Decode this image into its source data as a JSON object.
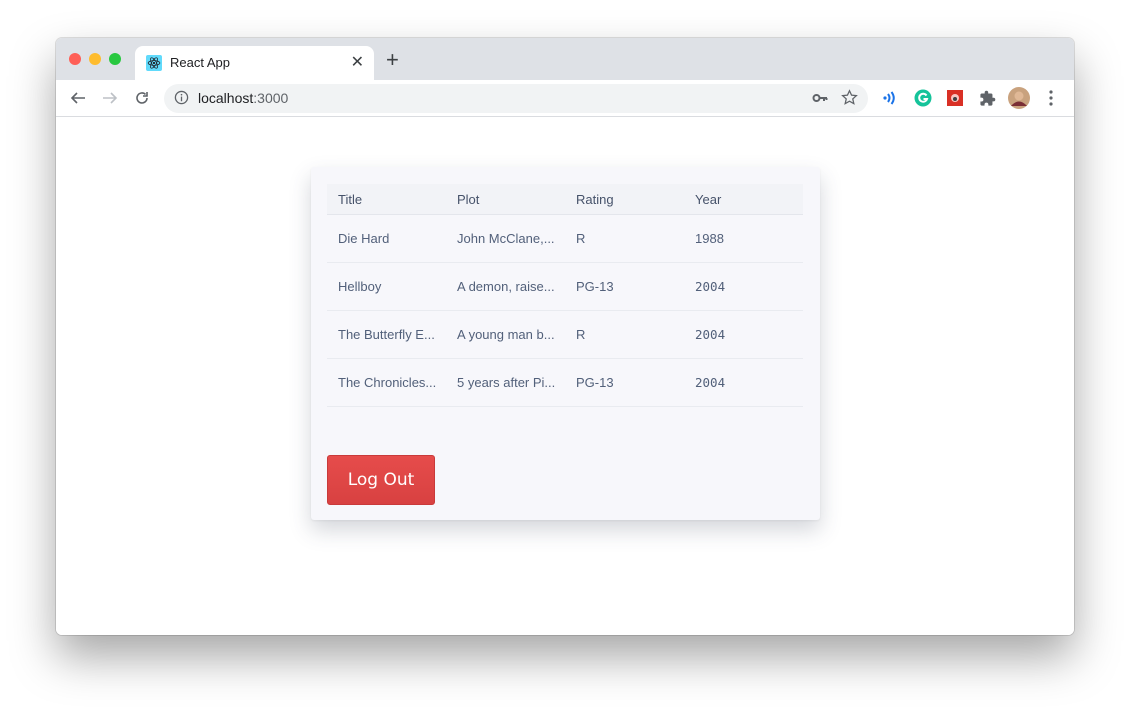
{
  "browser": {
    "tab_title": "React App",
    "new_tab_label": "+",
    "url_host": "localhost",
    "url_port": ":3000",
    "icons": {
      "favicon": "react-logo-icon",
      "close": "close-icon",
      "back": "arrow-left-icon",
      "forward": "arrow-right-icon",
      "reload": "reload-icon",
      "info": "info-icon",
      "key": "key-icon",
      "star": "star-icon",
      "extensions": [
        "wave-extension-icon",
        "grammarly-icon",
        "red-extension-icon",
        "puzzle-extensions-icon"
      ],
      "avatar": "profile-avatar",
      "menu": "kebab-menu-icon"
    },
    "colors": {
      "tabstrip": "#dee1e6",
      "traffic_red": "#fe5f57",
      "traffic_yellow": "#febc2e",
      "traffic_green": "#28c840"
    }
  },
  "table": {
    "columns": [
      "Title",
      "Plot",
      "Rating",
      "Year"
    ],
    "rows": [
      {
        "title": "Die Hard",
        "plot": "John McClane,...",
        "rating": "R",
        "year": "1988"
      },
      {
        "title": "Hellboy",
        "plot": "A demon, raise...",
        "rating": "PG-13",
        "year": "2004"
      },
      {
        "title": "The Butterfly E...",
        "plot": "A young man b...",
        "rating": "R",
        "year": "2004"
      },
      {
        "title": "The Chronicles...",
        "plot": "5 years after Pi...",
        "rating": "PG-13",
        "year": "2004"
      }
    ]
  },
  "logout_button": {
    "label": "Log Out",
    "color": "#e04646"
  }
}
